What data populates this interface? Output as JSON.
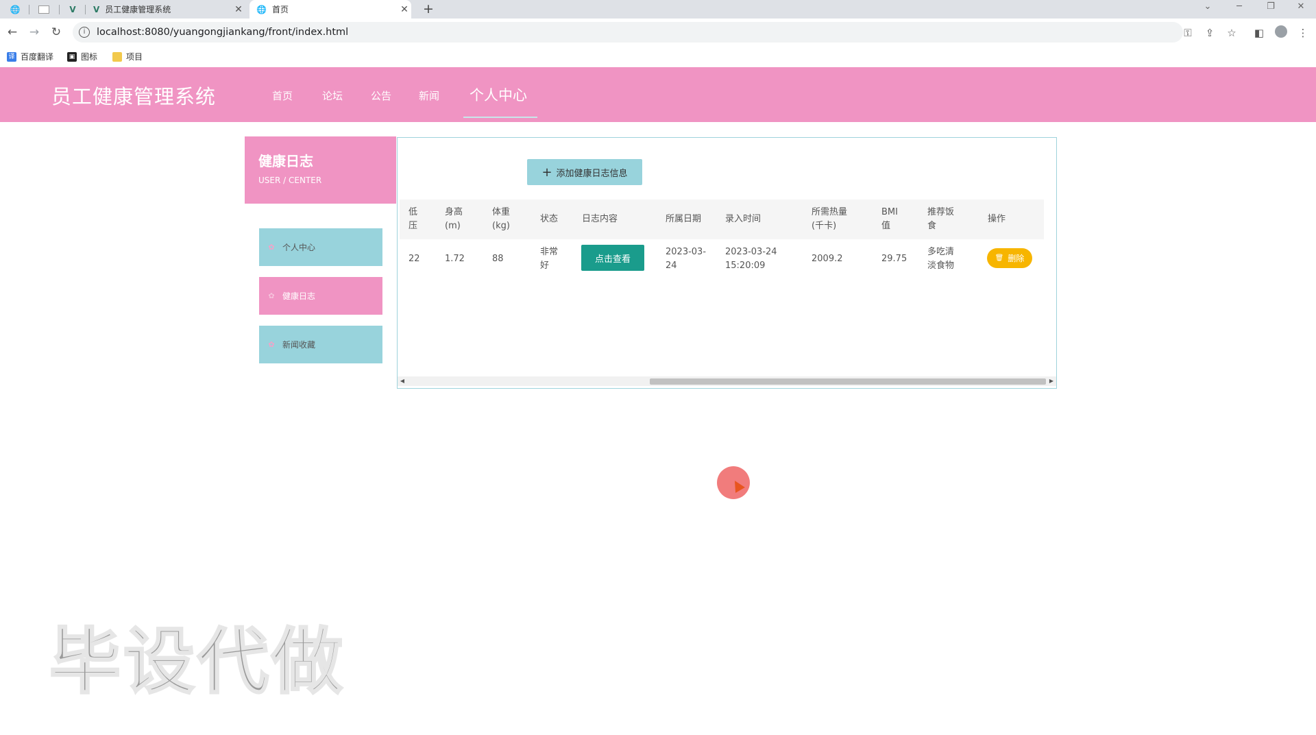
{
  "browser": {
    "tabs": [
      {
        "title": "员工健康管理系统",
        "close": "✕"
      },
      {
        "title": "首页",
        "close": "✕"
      }
    ],
    "new_tab": "+",
    "url": "localhost:8080/yuangongjiankang/front/index.html",
    "bookmarks": [
      "百度翻译",
      "图标",
      "项目"
    ]
  },
  "header": {
    "title": "员工健康管理系统",
    "nav": [
      "首页",
      "论坛",
      "公告",
      "新闻",
      "个人中心"
    ],
    "active_nav": "个人中心"
  },
  "sidebar": {
    "title": "健康日志",
    "subtitle": "USER / CENTER",
    "items": [
      "个人中心",
      "健康日志",
      "新闻收藏"
    ],
    "active": "健康日志"
  },
  "main": {
    "add_button": "添加健康日志信息",
    "columns": [
      "低\n压",
      "身高\n(m)",
      "体重\n(kg)",
      "状态",
      "日志内容",
      "所属日期",
      "录入时间",
      "所需热量\n(千卡)",
      "BMI\n值",
      "推荐饭\n食",
      "操作"
    ],
    "rows": [
      {
        "low_pressure": "22",
        "height": "1.72",
        "weight": "88",
        "status": "非常\n好",
        "content_button": "点击查看",
        "date": "2023-03-\n24",
        "entry_time": "2023-03-24\n15:20:09",
        "calories": "2009.2",
        "bmi": "29.75",
        "food": "多吃清\n淡食物",
        "delete_button": "删除"
      }
    ]
  },
  "watermark": "毕设代做",
  "colors": {
    "header_bg": "#f094c3",
    "side_btn_bg": "#98d3dc",
    "view_btn_bg": "#1a9c8c",
    "delete_btn_bg": "#f7b500"
  }
}
